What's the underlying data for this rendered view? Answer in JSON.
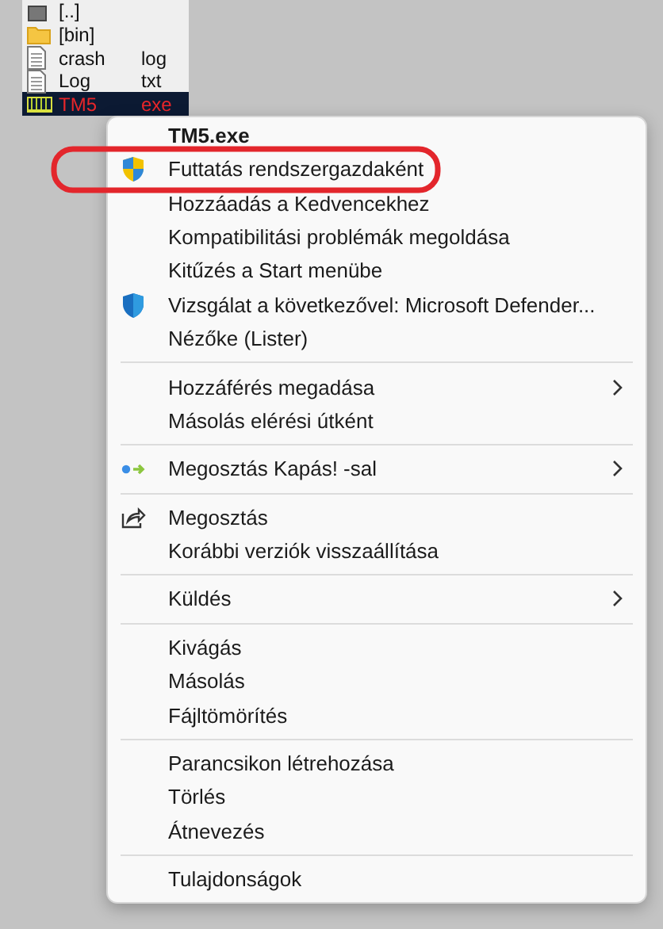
{
  "files": [
    {
      "name": "[..]",
      "kind": "up",
      "selected": false
    },
    {
      "name": "[bin]",
      "kind": "folder",
      "selected": false
    },
    {
      "name": "crash",
      "ext": "log",
      "kind": "file",
      "selected": false
    },
    {
      "name": "Log",
      "ext": "txt",
      "kind": "file",
      "selected": false
    },
    {
      "name": "TM5",
      "ext": "exe",
      "kind": "program",
      "selected": true
    }
  ],
  "context_menu": {
    "title": "TM5.exe",
    "items": [
      {
        "kind": "item",
        "label": "Futtatás rendszergazdaként",
        "submenu": false
      },
      {
        "kind": "item",
        "label": "Hozzáadás a Kedvencekhez",
        "submenu": false
      },
      {
        "kind": "item",
        "label": "Kompatibilitási problémák megoldása",
        "submenu": false
      },
      {
        "kind": "item",
        "label": "Kitűzés a Start menübe",
        "submenu": false
      },
      {
        "kind": "item",
        "label": "Vizsgálat a következővel: Microsoft Defender...",
        "submenu": false
      },
      {
        "kind": "item",
        "label": "Nézőke (Lister)",
        "submenu": false
      },
      {
        "kind": "separator"
      },
      {
        "kind": "item",
        "label": "Hozzáférés megadása",
        "submenu": true
      },
      {
        "kind": "item",
        "label": "Másolás elérési útként",
        "submenu": false
      },
      {
        "kind": "separator"
      },
      {
        "kind": "item",
        "label": "Megosztás Kapás! -sal",
        "submenu": true
      },
      {
        "kind": "separator"
      },
      {
        "kind": "item",
        "label": "Megosztás",
        "submenu": false
      },
      {
        "kind": "item",
        "label": "Korábbi verziók visszaállítása",
        "submenu": false
      },
      {
        "kind": "separator"
      },
      {
        "kind": "item",
        "label": "Küldés",
        "submenu": true
      },
      {
        "kind": "separator"
      },
      {
        "kind": "item",
        "label": "Kivágás",
        "submenu": false
      },
      {
        "kind": "item",
        "label": "Másolás",
        "submenu": false
      },
      {
        "kind": "item",
        "label": "Fájltömörítés",
        "submenu": false
      },
      {
        "kind": "separator"
      },
      {
        "kind": "item",
        "label": "Parancsikon létrehozása",
        "submenu": false
      },
      {
        "kind": "item",
        "label": "Törlés",
        "submenu": false
      },
      {
        "kind": "item",
        "label": "Átnevezés",
        "submenu": false
      },
      {
        "kind": "separator"
      },
      {
        "kind": "item",
        "label": "Tulajdonságok",
        "submenu": false
      }
    ]
  }
}
